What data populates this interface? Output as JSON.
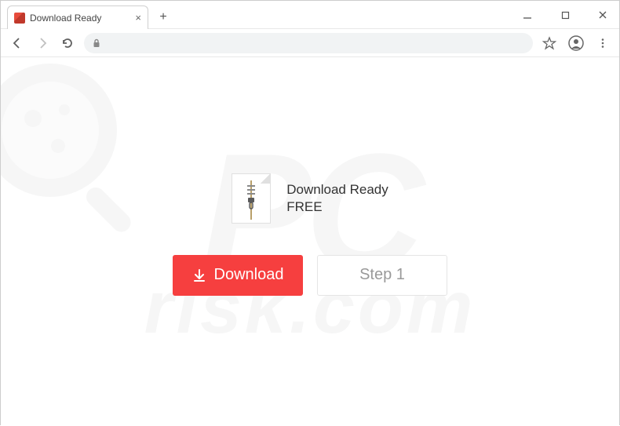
{
  "tab": {
    "title": "Download Ready"
  },
  "content": {
    "heading_line1": "Download Ready",
    "heading_line2": "FREE",
    "download_button": "Download",
    "step_button": "Step 1"
  },
  "watermark": {
    "line1": "PC",
    "line2": "risk.com"
  },
  "colors": {
    "download_button": "#f63f3f",
    "download_text": "#ffffff",
    "step_text": "#999999"
  }
}
